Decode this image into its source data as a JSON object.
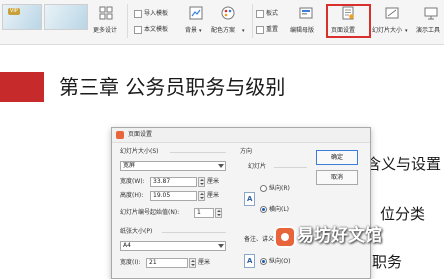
{
  "toolbar": {
    "more_designs": "更多设计",
    "vip_badge": "VIP",
    "import_template": "导入模板",
    "text_template": "本文模板",
    "background": "背景",
    "color_scheme": "配色方案",
    "format": "板式",
    "reset": "重置",
    "edit_master": "编辑母版",
    "page_setup": "页面设置",
    "slide_size": "幻灯片大小",
    "present": "演示工具"
  },
  "slide": {
    "title": "第三章  公务员职务与级别",
    "bg_text_1": "含义与设置",
    "bg_text_2": "位分类",
    "bg_text_3": "职务"
  },
  "dialog": {
    "title": "页面设置",
    "slide_size_label": "幻灯片大小(S)",
    "slide_size_value": "宽屏",
    "width_label": "宽度(W):",
    "width_value": "33.87",
    "height_label": "高度(H):",
    "height_value": "19.05",
    "unit_cm": "厘米",
    "start_number_label": "幻灯片编号起始值(N):",
    "start_number_value": "1",
    "paper_size_label": "纸张大小(P)",
    "paper_size_value": "A4",
    "paper_width_label": "宽度(I):",
    "paper_width_value": "21",
    "direction_label": "方向",
    "slide_group_label": "幻灯片",
    "portrait_label": "纵向(R)",
    "landscape_label": "横向(L)",
    "notes_label": "备注、讲义和大纲",
    "notes_portrait_label": "纵向(O)",
    "ok_button": "确定",
    "cancel_button": "取消"
  },
  "watermark": {
    "text": "易坊好文馆"
  }
}
